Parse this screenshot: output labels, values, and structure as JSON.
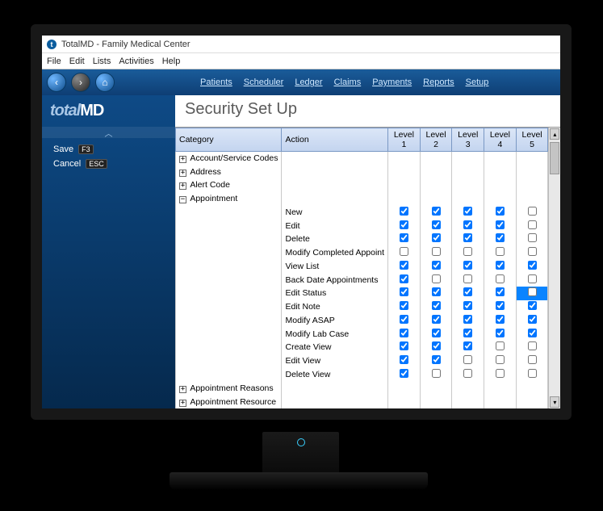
{
  "window": {
    "title": "TotalMD - Family Medical Center"
  },
  "menubar": [
    "File",
    "Edit",
    "Lists",
    "Activities",
    "Help"
  ],
  "toolbar_links": [
    "Patients",
    "Scheduler",
    "Ledger",
    "Claims",
    "Payments",
    "Reports",
    "Setup"
  ],
  "logo": {
    "left": "total",
    "right": "MD"
  },
  "sidebar": {
    "save_label": "Save",
    "save_key": "F3",
    "cancel_label": "Cancel",
    "cancel_key": "ESC"
  },
  "page": {
    "title": "Security Set Up"
  },
  "columns": [
    "Category",
    "Action",
    "Level 1",
    "Level 2",
    "Level 3",
    "Level 4",
    "Level 5"
  ],
  "categories": [
    {
      "name": "Account/Service Codes",
      "expanded": false
    },
    {
      "name": "Address",
      "expanded": false
    },
    {
      "name": "Alert Code",
      "expanded": false
    },
    {
      "name": "Appointment",
      "expanded": true,
      "actions": [
        {
          "name": "New",
          "levels": [
            true,
            true,
            true,
            true,
            false
          ]
        },
        {
          "name": "Edit",
          "levels": [
            true,
            true,
            true,
            true,
            false
          ]
        },
        {
          "name": "Delete",
          "levels": [
            true,
            true,
            true,
            true,
            false
          ]
        },
        {
          "name": "Modify Completed Appoint",
          "levels": [
            false,
            false,
            false,
            false,
            false
          ]
        },
        {
          "name": "View List",
          "levels": [
            true,
            true,
            true,
            true,
            true
          ]
        },
        {
          "name": "Back Date Appointments",
          "levels": [
            true,
            false,
            false,
            false,
            false
          ]
        },
        {
          "name": "Edit Status",
          "levels": [
            true,
            true,
            true,
            true,
            false
          ],
          "selected_col": 4
        },
        {
          "name": "Edit Note",
          "levels": [
            true,
            true,
            true,
            true,
            true
          ]
        },
        {
          "name": "Modify ASAP",
          "levels": [
            true,
            true,
            true,
            true,
            true
          ]
        },
        {
          "name": "Modify Lab Case",
          "levels": [
            true,
            true,
            true,
            true,
            true
          ]
        },
        {
          "name": "Create View",
          "levels": [
            true,
            true,
            true,
            false,
            false
          ]
        },
        {
          "name": "Edit View",
          "levels": [
            true,
            true,
            false,
            false,
            false
          ]
        },
        {
          "name": "Delete View",
          "levels": [
            true,
            false,
            false,
            false,
            false
          ]
        }
      ]
    },
    {
      "name": "Appointment Reasons",
      "expanded": false
    },
    {
      "name": "Appointment Resource",
      "expanded": false
    }
  ]
}
